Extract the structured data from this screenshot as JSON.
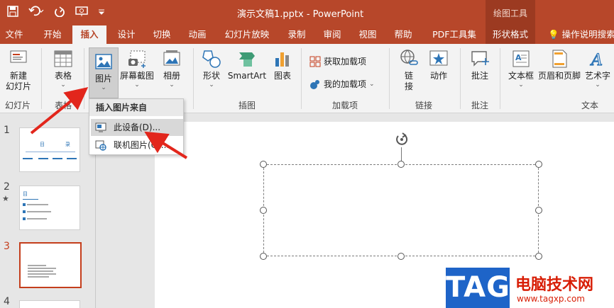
{
  "title_bar": {
    "document_title": "演示文稿1.pptx  -  PowerPoint",
    "context_group": "绘图工具",
    "quick_access": [
      "save-icon",
      "undo-icon",
      "redo-icon",
      "present-icon",
      "customize-icon"
    ]
  },
  "tabs": [
    {
      "label": "文件"
    },
    {
      "label": "开始"
    },
    {
      "label": "插入",
      "active": true
    },
    {
      "label": "设计"
    },
    {
      "label": "切换"
    },
    {
      "label": "动画"
    },
    {
      "label": "幻灯片放映"
    },
    {
      "label": "录制"
    },
    {
      "label": "审阅"
    },
    {
      "label": "视图"
    },
    {
      "label": "帮助"
    },
    {
      "label": "PDF工具集"
    },
    {
      "label": "形状格式"
    }
  ],
  "tell_me": "操作说明搜索",
  "ribbon": {
    "new_slide": "新建\n幻灯片",
    "table": "表格",
    "picture": "图片",
    "screenshot": "屏幕截图",
    "album": "相册",
    "shapes": "形状",
    "smartart": "SmartArt",
    "chart": "图表",
    "get_addins": "获取加载项",
    "my_addins": "我的加载项",
    "link": "链\n接",
    "action": "动作",
    "comment": "批注",
    "textbox": "文本框",
    "header_footer": "页眉和页脚",
    "wordart": "艺术字",
    "groups": {
      "slides": "幻灯片",
      "tables": "表格",
      "images": "插图",
      "addins": "加载项",
      "links": "链接",
      "comments": "批注",
      "text": "文本"
    }
  },
  "dropdown": {
    "header": "插入图片来自",
    "items": [
      {
        "label": "此设备(D)...",
        "icon": "device-icon",
        "highlighted": true
      },
      {
        "label": "联机图片(O)...",
        "icon": "online-picture-icon",
        "highlighted": false
      }
    ]
  },
  "thumbnails": [
    {
      "number": "1",
      "title": "目    录"
    },
    {
      "number": "2",
      "title": "目"
    },
    {
      "number": "3"
    },
    {
      "number": "4"
    }
  ],
  "watermark": {
    "tag": "TAG",
    "site_name": "电脑技术网",
    "url": "www.tagxp.com"
  },
  "colors": {
    "accent": "#b7472a",
    "context_tab": "#9c3a21",
    "selected_thumb": "#c43e1c",
    "arrow": "#e2261c"
  }
}
